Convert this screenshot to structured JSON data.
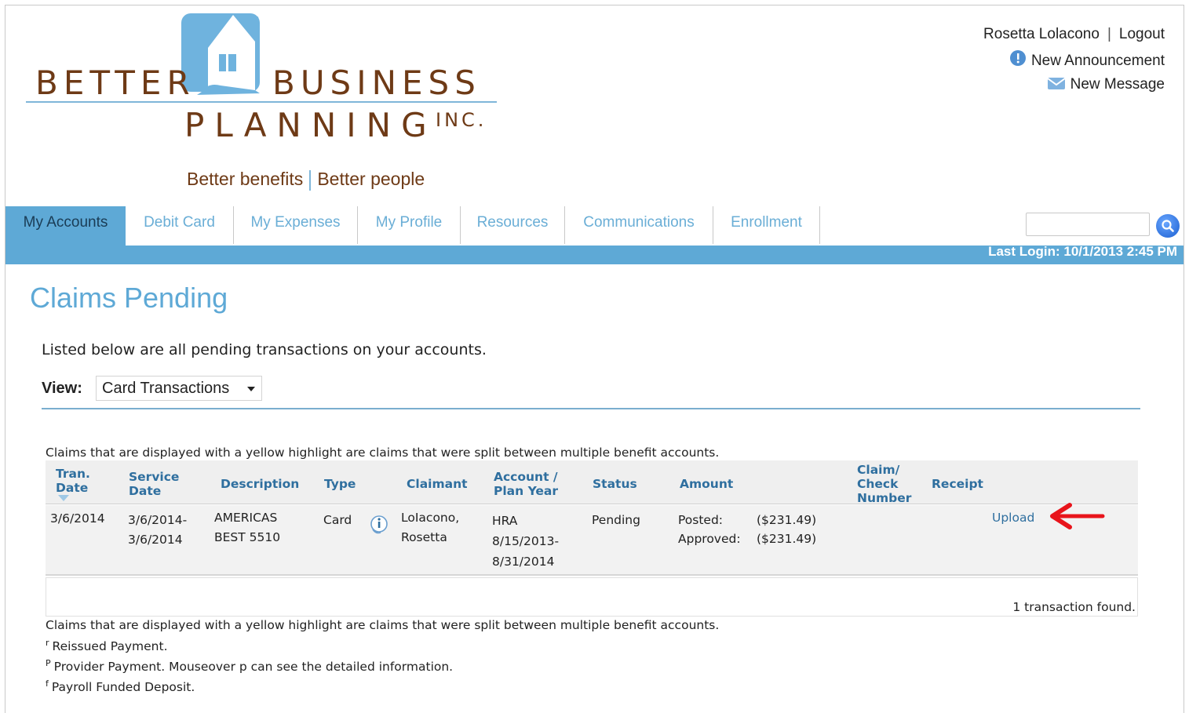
{
  "branding": {
    "logo_word1": "BETTER",
    "logo_word2": "BUSINESS",
    "logo_word3": "PLANNING",
    "logo_suffix": "INC.",
    "tagline_left": "Better benefits",
    "tagline_right": "Better people",
    "brand_color": "#6e3a16",
    "accent_color": "#5ea9d6"
  },
  "user": {
    "name": "Rosetta Lolacono",
    "logout_label": "Logout",
    "announcement_label": "New Announcement",
    "message_label": "New Message",
    "announcement_icon": "info-icon",
    "message_icon": "envelope-icon"
  },
  "nav": {
    "tabs": [
      {
        "label": "My Accounts",
        "active": true
      },
      {
        "label": "Debit Card",
        "active": false
      },
      {
        "label": "My Expenses",
        "active": false
      },
      {
        "label": "My Profile",
        "active": false
      },
      {
        "label": "Resources",
        "active": false
      },
      {
        "label": "Communications",
        "active": false
      },
      {
        "label": "Enrollment",
        "active": false
      }
    ],
    "search_placeholder": "",
    "search_icon": "search-icon",
    "last_login": "Last Login: 10/1/2013 2:45 PM"
  },
  "page": {
    "title": "Claims Pending",
    "intro": "Listed below are all pending transactions on your accounts.",
    "view_label": "View:",
    "view_selected": "Card Transactions",
    "split_note": "Claims that are displayed with a yellow highlight are claims that were split between multiple benefit accounts."
  },
  "table": {
    "headers": {
      "tran_date": [
        "Tran.",
        "Date"
      ],
      "service_date": [
        "Service",
        "Date"
      ],
      "description": "Description",
      "type": "Type",
      "claimant": "Claimant",
      "account": [
        "Account /",
        "Plan Year"
      ],
      "status": "Status",
      "amount": "Amount",
      "claim_check": [
        "Claim/",
        "Check",
        "Number"
      ],
      "receipt": "Receipt"
    },
    "rows": [
      {
        "tran_date": "3/6/2014",
        "service_date": [
          "3/6/2014-",
          "3/6/2014"
        ],
        "description": [
          "AMERICAS",
          "BEST 5510"
        ],
        "type": "Card",
        "claimant": [
          "LoIacono,",
          "Rosetta"
        ],
        "account": [
          "HRA",
          "8/15/2013-",
          "8/31/2014"
        ],
        "status": "Pending",
        "posted_label": "Posted:",
        "posted_value": "($231.49)",
        "approved_label": "Approved:",
        "approved_value": "($231.49)",
        "claim_check": "",
        "receipt_link": "Upload"
      }
    ],
    "found_text": "1 transaction found."
  },
  "legend": {
    "reissued_mark": "r",
    "reissued": "Reissued Payment.",
    "provider_mark": "P",
    "provider": "Provider Payment. Mouseover p can see the detailed information.",
    "payroll_mark": "f",
    "payroll": "Payroll Funded Deposit."
  }
}
